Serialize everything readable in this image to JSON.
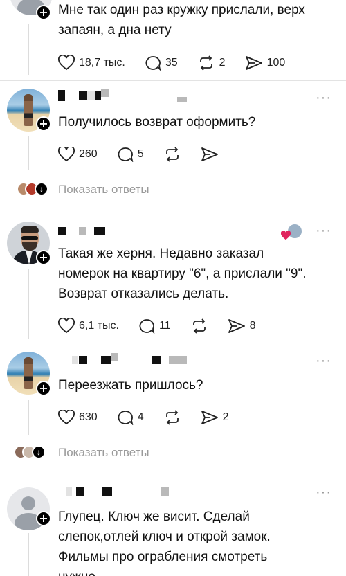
{
  "comments": [
    {
      "text": "Мне так один раз кружку прислали, верх\nзапаян, а дна нету",
      "likes": "18,7 тыс.",
      "replies": "35",
      "reposts": "2",
      "shares": "100"
    },
    {
      "text": "Получилось возврат оформить?",
      "likes": "260",
      "replies": "5",
      "reposts": "",
      "shares": ""
    },
    {
      "text": "Такая же херня. Недавно заказал\nномерок на квартиру \"6\", а прислали \"9\".\nВозврат отказались делать.",
      "likes": "6,1 тыс.",
      "replies": "11",
      "reposts": "",
      "shares": "8"
    },
    {
      "text": "Переезжать пришлось?",
      "likes": "630",
      "replies": "4",
      "reposts": "",
      "shares": "2"
    },
    {
      "text": "Глупец. Ключ же висит. Сделай\nслепок,отлей ключ и открой замок.\nФильмы про ограбления смотреть\nнужно"
    }
  ],
  "show_replies_label": "Показать ответы",
  "icons": [
    "heart-icon",
    "comment-icon",
    "repost-icon",
    "share-icon",
    "more-icon",
    "follow-plus-icon",
    "chevron-down-icon"
  ],
  "colors": {
    "text": "#111111",
    "muted": "#9a9a9a",
    "like_red": "#e0245e"
  }
}
